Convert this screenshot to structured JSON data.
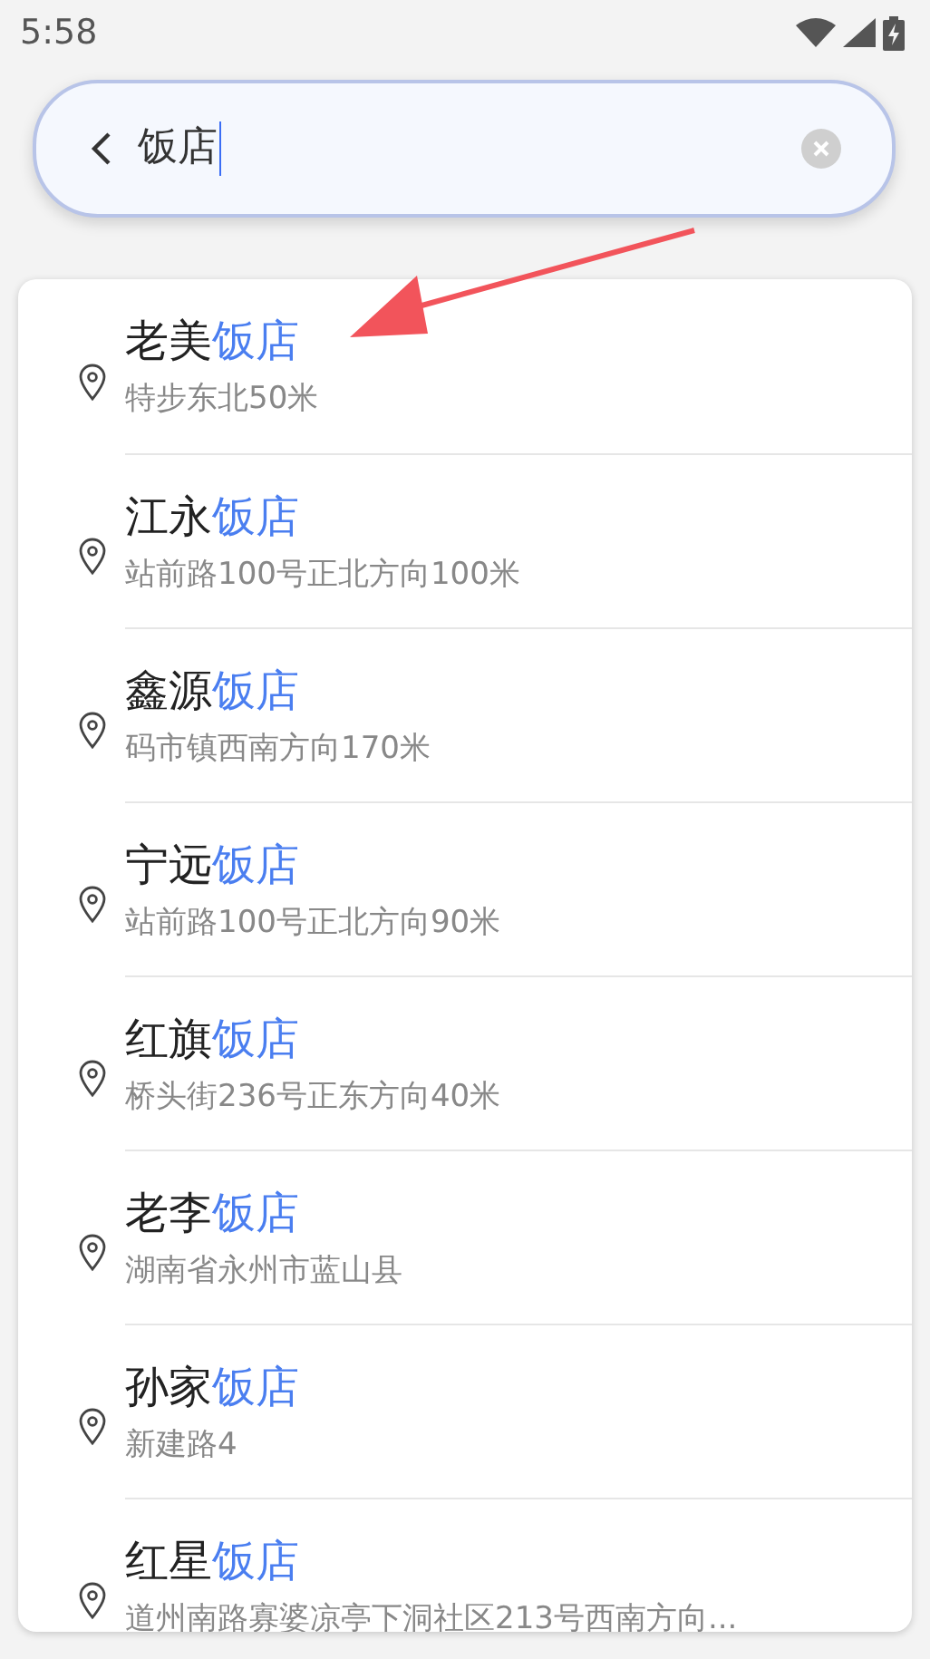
{
  "status_bar": {
    "time": "5:58"
  },
  "search": {
    "value": "饭店"
  },
  "results": [
    {
      "name": "老美",
      "keyword": "饭店",
      "address": "特步东北50米"
    },
    {
      "name": "江永",
      "keyword": "饭店",
      "address": "站前路100号正北方向100米"
    },
    {
      "name": "鑫源",
      "keyword": "饭店",
      "address": "码市镇西南方向170米"
    },
    {
      "name": "宁远",
      "keyword": "饭店",
      "address": "站前路100号正北方向90米"
    },
    {
      "name": "红旗",
      "keyword": "饭店",
      "address": "桥头街236号正东方向40米"
    },
    {
      "name": "老李",
      "keyword": "饭店",
      "address": "湖南省永州市蓝山县"
    },
    {
      "name": "孙家",
      "keyword": "饭店",
      "address": "新建路4"
    },
    {
      "name": "红星",
      "keyword": "饭店",
      "address": "道州南路寡婆凉亭下洞社区213号西南方向..."
    }
  ]
}
